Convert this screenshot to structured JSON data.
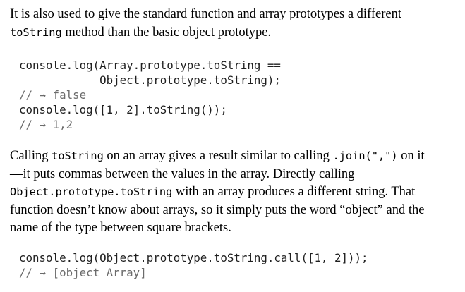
{
  "para1": {
    "text_a": "It is also used to give the standard function and array prototypes a different",
    "code_a": "toString",
    "text_b": " method than the basic object prototype."
  },
  "code1": {
    "line1": "console.log(Array.prototype.toString ==",
    "line2": "            Object.prototype.toString);",
    "line3": "// → false",
    "line4": "console.log([1, 2].toString());",
    "line5": "// → 1,2"
  },
  "para2": {
    "t1": "Calling ",
    "c1": "toString",
    "t2": " on an array gives a result similar to calling ",
    "c2": ".join(\",\")",
    "t3": " on it",
    "t4": "—it puts commas between the values in the array. Directly calling",
    "c3": "Object.prototype.toString",
    "t5": " with an array produces a different string. That",
    "t6": "function doesn’t know about arrays, so it simply puts the word “object” and the",
    "t7": "name of the type between square brackets."
  },
  "code2": {
    "line1": "console.log(Object.prototype.toString.call([1, 2]));",
    "line2": "// → [object Array]"
  }
}
